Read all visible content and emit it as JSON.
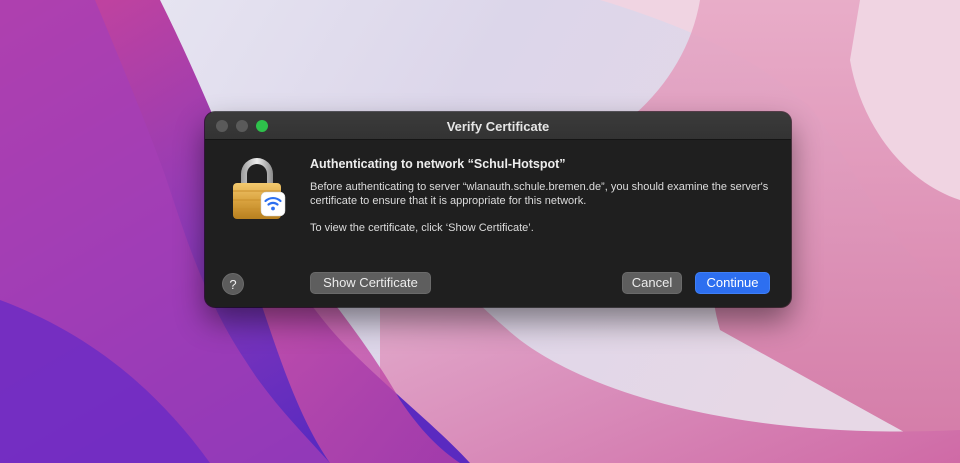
{
  "dialog": {
    "title": "Verify Certificate",
    "heading": "Authenticating to network “Schul-Hotspot”",
    "body": "Before authenticating to server “wlanauth.schule.bremen.de”, you should examine the server's certificate to ensure that it is appropriate for this network.",
    "instruction": "To view the certificate, click ‘Show Certificate’.",
    "help_label": "?",
    "show_certificate_label": "Show Certificate",
    "cancel_label": "Cancel",
    "continue_label": "Continue",
    "icon": "lock-with-wifi-icon"
  },
  "colors": {
    "dialog_bg": "#1f1f1f",
    "titlebar": "#363636",
    "accent": "#2d6ff0",
    "zoom_button": "#2ec14b"
  }
}
